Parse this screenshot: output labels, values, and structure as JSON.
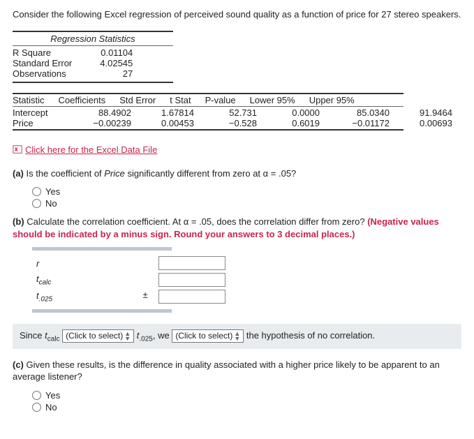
{
  "intro": "Consider the following Excel regression of perceived sound quality as a function of price for 27 stereo speakers.",
  "stats_header": "Regression Statistics",
  "stats_rows": [
    {
      "label": "R Square",
      "value": "0.01104"
    },
    {
      "label": "Standard Error",
      "value": "4.02545"
    },
    {
      "label": "Observations",
      "value": "27"
    }
  ],
  "coef_headers": [
    "Statistic",
    "Coefficients",
    "Std Error",
    "t Stat",
    "P-value",
    "Lower 95%",
    "Upper 95%"
  ],
  "coef_rows": [
    {
      "label": "Intercept",
      "coef": "88.4902",
      "se": "1.67814",
      "t": "52.731",
      "p": "0.0000",
      "lo": "85.0340",
      "hi": "91.9464"
    },
    {
      "label": "Price",
      "coef": "−0.00239",
      "se": "0.00453",
      "t": "−0.528",
      "p": "0.6019",
      "lo": "−0.01172",
      "hi": "0.00693"
    }
  ],
  "excel_link": "Click here for the Excel Data File",
  "qa": {
    "label": "(a)",
    "text_pre": "Is the coefficient of ",
    "text_ital": "Price",
    "text_post": " significantly different from zero at α = .05?",
    "yes": "Yes",
    "no": "No"
  },
  "qb": {
    "label": "(b)",
    "text": "Calculate the correlation coefficient. At α = .05, does the correlation differ from zero? ",
    "red": "(Negative values should be indicated by a minus sign. Round your answers to 3 decimal places.)",
    "rows": {
      "r": "r",
      "tcalc_t": "t",
      "tcalc_sub": "calc",
      "t025_t": "t",
      "t025_sub": ".025",
      "pm": "±"
    }
  },
  "since": {
    "pre": "Since ",
    "t": "t",
    "calc": "calc",
    "sel1": "(Click to select)",
    "mid_t": " t",
    "mid_sub": ".025",
    "mid_txt": ", we ",
    "sel2": "(Click to select)",
    "post": " the hypothesis of no correlation."
  },
  "qc": {
    "label": "(c)",
    "text": "Given these results, is the difference in quality associated with a higher price likely to be apparent to an average listener?",
    "yes": "Yes",
    "no": "No"
  }
}
